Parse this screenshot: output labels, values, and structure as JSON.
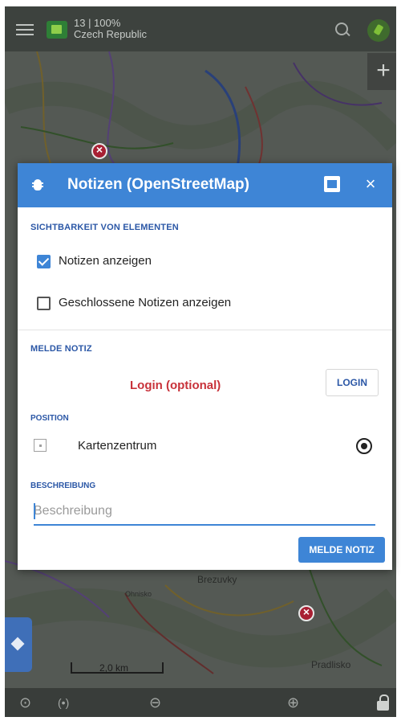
{
  "map": {
    "zoom_label": "13 | 100%",
    "country": "Czech Republic",
    "scale_label": "2,0 km",
    "place_labels": [
      "Brezuvky",
      "Pradlisko",
      "Ohnisko"
    ],
    "icons": [
      "menu-icon",
      "map-source-icon",
      "search-icon",
      "gps-icon",
      "plus-icon",
      "layers-icon",
      "lock-icon"
    ]
  },
  "bottombar": {
    "locate_icon": "⊙",
    "guide_icon": "(•)",
    "zoom_out_icon": "⊖",
    "zoom_in_icon": "⊕"
  },
  "dialog": {
    "title": "Notizen (OpenStreetMap)",
    "close_label": "×",
    "visibility_section": {
      "heading": "SICHTBARKEIT VON ELEMENTEN",
      "options": [
        {
          "label": "Notizen anzeigen",
          "checked": true
        },
        {
          "label": "Geschlossene Notizen anzeigen",
          "checked": false
        }
      ]
    },
    "report_section": {
      "heading": "MELDE NOTIZ",
      "login_text": "Login (optional)",
      "login_button": "LOGIN",
      "position_label": "POSITION",
      "position_value": "Kartenzentrum",
      "description_label": "BESCHREIBUNG",
      "description_placeholder": "Beschreibung",
      "description_value": "",
      "submit_button": "MELDE NOTIZ"
    }
  },
  "colors": {
    "accent": "#3e85d6",
    "section_heading": "#2b57a6",
    "login_text": "#c8323a"
  }
}
